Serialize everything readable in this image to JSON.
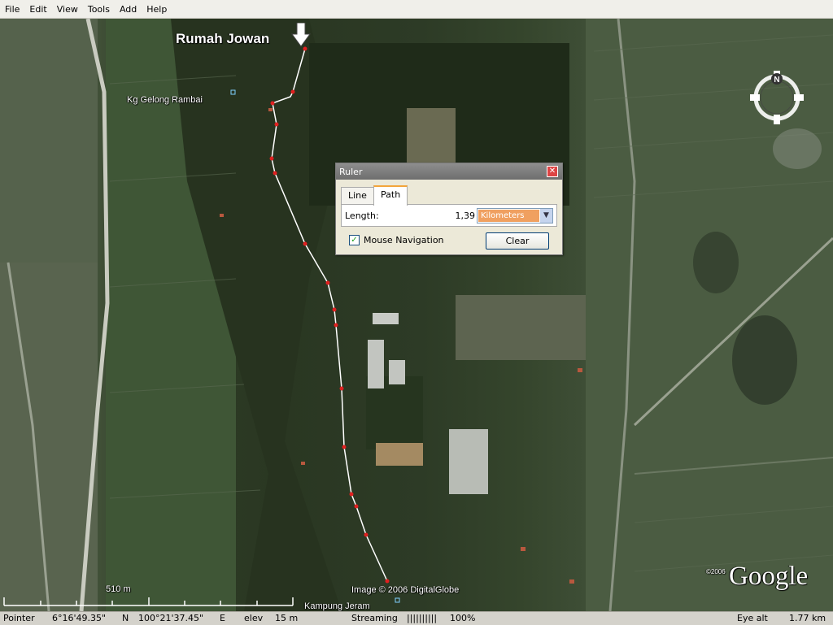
{
  "menu": [
    "File",
    "Edit",
    "View",
    "Tools",
    "Add",
    "Help"
  ],
  "map": {
    "places": {
      "rumah_jowan": "Rumah Jowan",
      "kg_gelong_rambai": "Kg Gelong Rambai",
      "kampung_jeram": "Kampung Jeram"
    },
    "scale_label": "510 m",
    "copyright": "Image © 2006 DigitalGlobe",
    "logo_year": "©2006",
    "logo_text": "Google",
    "compass_north": "N"
  },
  "ruler": {
    "title": "Ruler",
    "tabs": [
      "Line",
      "Path"
    ],
    "active_tab": "Path",
    "length_label": "Length:",
    "length_value": "1,39",
    "unit_selected": "Kilometers",
    "mouse_navigation_label": "Mouse Navigation",
    "mouse_navigation_checked": true,
    "clear_label": "Clear"
  },
  "status": {
    "pointer_label": "Pointer",
    "lat": "6°16'49.35\"",
    "lat_dir": "N",
    "lon": "100°21'37.45\"",
    "lon_dir": "E",
    "elev_label": "elev",
    "elev_value": "15 m",
    "streaming_label": "Streaming",
    "streaming_bar": "||||||||||",
    "streaming_pct": "100%",
    "eye_alt_label": "Eye alt",
    "eye_alt_value": "1.77 km"
  },
  "colors": {
    "path_line": "#ffffff",
    "path_point": "#e02020",
    "tab_accent": "#f3a53b"
  }
}
